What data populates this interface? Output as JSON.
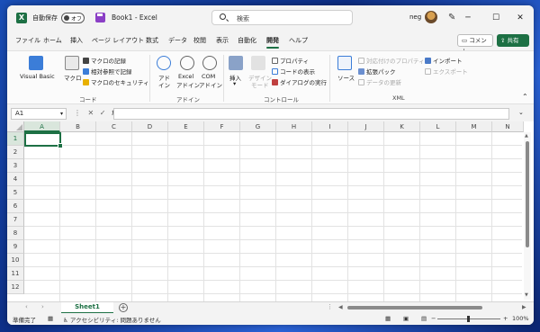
{
  "titlebar": {
    "app_icon_letter": "X",
    "autosave_label": "自動保存",
    "autosave_state": "オフ",
    "document_title": "Book1 - Excel",
    "search_placeholder": "検索",
    "user_name": "neg",
    "minimize": "─",
    "maximize": "☐",
    "close": "✕"
  },
  "ribbon_tabs": [
    {
      "label": "ファイル"
    },
    {
      "label": "ホーム"
    },
    {
      "label": "挿入"
    },
    {
      "label": "ページ レイアウト"
    },
    {
      "label": "数式"
    },
    {
      "label": "データ"
    },
    {
      "label": "校閲"
    },
    {
      "label": "表示"
    },
    {
      "label": "自動化"
    },
    {
      "label": "開発",
      "active": true
    },
    {
      "label": "ヘルプ"
    }
  ],
  "ribbon_actions": {
    "comment_label": "コメント",
    "share_label": "共有"
  },
  "ribbon": {
    "code": {
      "visual_basic": "Visual Basic",
      "macro": "マクロ",
      "record_macro": "マクロの記録",
      "relative_ref": "相対参照で記録",
      "macro_security": "マクロのセキュリティ",
      "group_label": "コード"
    },
    "addins": {
      "addins_1": "アド",
      "addins_2": "イン",
      "excel_addins_1": "Excel",
      "excel_addins_2": "アドイン",
      "com_addins_1": "COM",
      "com_addins_2": "アドイン",
      "group_label": "アドイン"
    },
    "controls": {
      "insert": "挿入",
      "design_mode_1": "デザイン",
      "design_mode_2": "モード",
      "properties": "プロパティ",
      "view_code": "コードの表示",
      "run_dialog": "ダイアログの実行",
      "group_label": "コントロール"
    },
    "xml": {
      "source": "ソース",
      "map_properties": "対応付けのプロパティ",
      "expansion_packs": "拡張パック",
      "refresh_data": "データの更新",
      "import": "インポート",
      "export": "エクスポート",
      "group_label": "XML"
    }
  },
  "formula_bar": {
    "name_box": "A1",
    "cancel": "✕",
    "enter": "✓",
    "fx": "fx",
    "formula": ""
  },
  "grid": {
    "columns": [
      "A",
      "B",
      "C",
      "D",
      "E",
      "F",
      "G",
      "H",
      "I",
      "J",
      "K",
      "L",
      "M",
      "N"
    ],
    "rows": [
      "1",
      "2",
      "3",
      "4",
      "5",
      "6",
      "7",
      "8",
      "9",
      "10",
      "11",
      "12"
    ],
    "selected_cell": "A1"
  },
  "sheets": {
    "tabs": [
      "Sheet1"
    ],
    "active": "Sheet1",
    "add_symbol": "+"
  },
  "statusbar": {
    "ready": "準備完了",
    "accessibility": "アクセシビリティ: 問題ありません",
    "zoom_minus": "−",
    "zoom_plus": "+",
    "zoom_level": "100%"
  },
  "colors": {
    "excel_green": "#1d7044",
    "share_green": "#1d7044",
    "desktop_blue": "#1a4fb8"
  }
}
